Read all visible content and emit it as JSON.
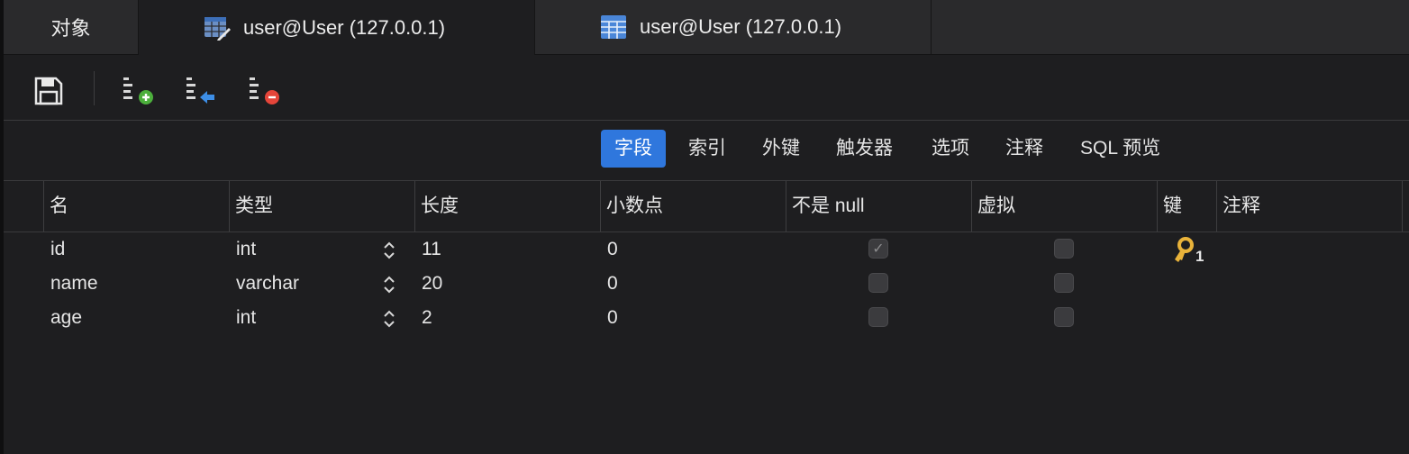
{
  "tabs": [
    {
      "label": "对象",
      "icon": null
    },
    {
      "label": "user@User (127.0.0.1)",
      "icon": "table-edit-icon"
    },
    {
      "label": "user@User (127.0.0.1)",
      "icon": "table-icon"
    }
  ],
  "toolbar": {
    "buttons": [
      "save-icon",
      "add-field-icon",
      "insert-field-icon",
      "delete-field-icon"
    ]
  },
  "subtabs": [
    "字段",
    "索引",
    "外键",
    "触发器",
    "选项",
    "注释",
    "SQL 预览"
  ],
  "subtabs_active": 0,
  "columns": [
    "名",
    "类型",
    "长度",
    "小数点",
    "不是 null",
    "虚拟",
    "键",
    "注释"
  ],
  "rows": [
    {
      "name": "id",
      "type": "int",
      "length": "11",
      "decimals": "0",
      "not_null": true,
      "virtual": false,
      "key": "1"
    },
    {
      "name": "name",
      "type": "varchar",
      "length": "20",
      "decimals": "0",
      "not_null": false,
      "virtual": false,
      "key": ""
    },
    {
      "name": "age",
      "type": "int",
      "length": "2",
      "decimals": "0",
      "not_null": false,
      "virtual": false,
      "key": ""
    }
  ],
  "colors": {
    "accent": "#2f77dd",
    "key": "#e9b33a",
    "background": "#1e1e20"
  }
}
